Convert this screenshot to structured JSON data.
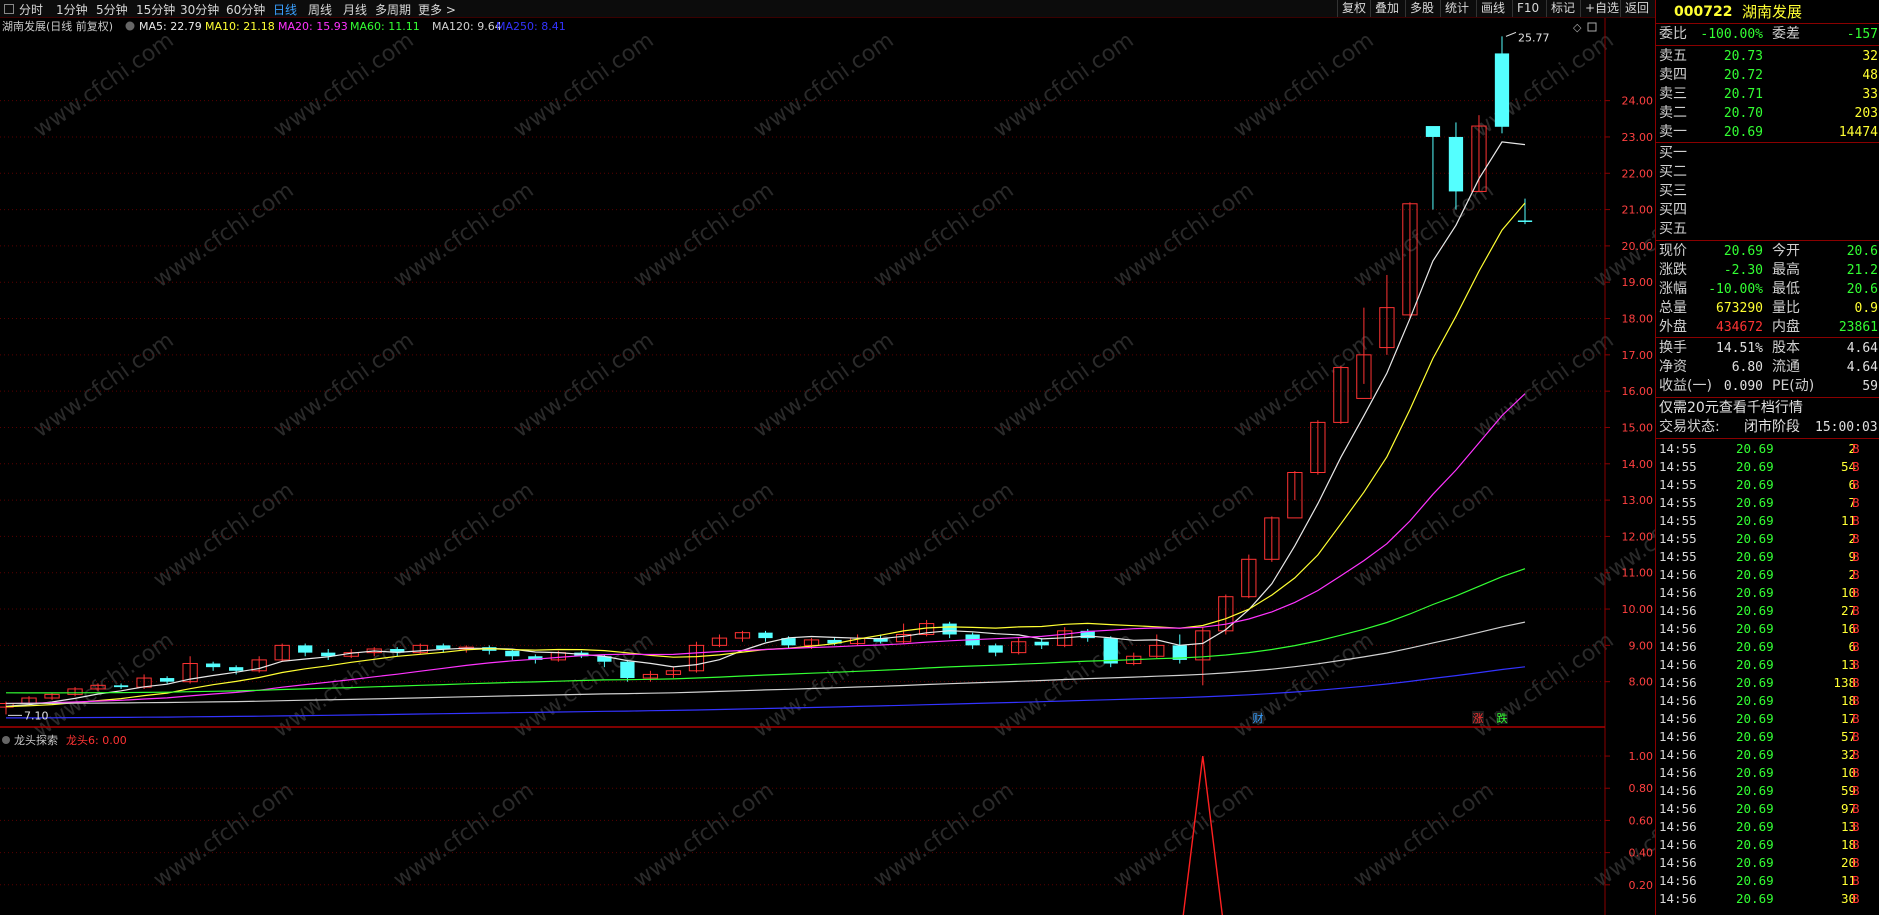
{
  "toolbar": {
    "periods": [
      "分时",
      "1分钟",
      "5分钟",
      "15分钟",
      "30分钟",
      "60分钟",
      "日线",
      "周线",
      "月线",
      "多周期",
      "更多 >"
    ],
    "active_period": "日线",
    "right_buttons": [
      "复权",
      "叠加",
      "多股",
      "统计",
      "画线",
      "F10",
      "标记",
      "+自选",
      "返回"
    ]
  },
  "chart": {
    "title": "湖南发展(日线 前复权)",
    "ma_legend": [
      {
        "label": "MA5: 22.79",
        "color": "#e8e8e8"
      },
      {
        "label": "MA10: 21.18",
        "color": "#ffff33"
      },
      {
        "label": "MA20: 15.93",
        "color": "#ff33ff"
      },
      {
        "label": "MA60: 11.11",
        "color": "#33ff33"
      },
      {
        "label": "MA120: 9.64",
        "color": "#d0d0d0"
      },
      {
        "label": "MA250: 8.41",
        "color": "#3333ff"
      }
    ],
    "high_label": "25.77",
    "low_label": "7.10",
    "markers": [
      {
        "text": "财",
        "color": "#3aa0ff"
      },
      {
        "text": "涨",
        "color": "#ff3333"
      },
      {
        "text": "跌",
        "color": "#33ff33"
      }
    ],
    "indicator_title": "龙头探索",
    "indicator_value": "龙头6: 0.00",
    "watermark": "www.cfchi.com",
    "price_axis": [
      "24.00",
      "23.00",
      "22.00",
      "21.00",
      "20.00",
      "19.00",
      "18.00",
      "17.00",
      "16.00",
      "15.00",
      "14.00",
      "13.00",
      "12.00",
      "11.00",
      "10.00",
      "9.00",
      "8.00"
    ],
    "ind_axis": [
      "1.00",
      "0.80",
      "0.60",
      "0.40",
      "0.20"
    ],
    "colors": {
      "up": "#ff3333",
      "down": "#54ffff",
      "grid": "#5a0000",
      "axis": "#8a0000"
    }
  },
  "chart_data": {
    "type": "candlestick",
    "note_axes": "price y-axis 8.00–24.00; indicator y-axis 0.20–1.00",
    "ylim": [
      7.0,
      26.0
    ],
    "candles": [
      [
        7.3,
        7.4,
        7.45,
        7.1
      ],
      [
        7.4,
        7.55,
        7.6,
        7.35
      ],
      [
        7.55,
        7.65,
        7.7,
        7.5
      ],
      [
        7.65,
        7.8,
        7.85,
        7.6
      ],
      [
        7.8,
        7.9,
        7.95,
        7.75
      ],
      [
        7.9,
        7.85,
        7.95,
        7.8
      ],
      [
        7.85,
        8.1,
        8.2,
        7.8
      ],
      [
        8.1,
        8.0,
        8.15,
        7.95
      ],
      [
        8.0,
        8.5,
        8.7,
        7.95
      ],
      [
        8.5,
        8.4,
        8.55,
        8.3
      ],
      [
        8.4,
        8.3,
        8.45,
        8.2
      ],
      [
        8.3,
        8.6,
        8.7,
        8.25
      ],
      [
        8.6,
        9.0,
        9.05,
        8.55
      ],
      [
        9.0,
        8.8,
        9.05,
        8.7
      ],
      [
        8.8,
        8.7,
        8.9,
        8.6
      ],
      [
        8.7,
        8.8,
        8.9,
        8.65
      ],
      [
        8.8,
        8.9,
        8.95,
        8.7
      ],
      [
        8.9,
        8.8,
        8.95,
        8.7
      ],
      [
        8.8,
        9.0,
        9.05,
        8.75
      ],
      [
        9.0,
        8.9,
        9.05,
        8.8
      ],
      [
        8.9,
        8.95,
        9.0,
        8.8
      ],
      [
        8.95,
        8.85,
        9.0,
        8.75
      ],
      [
        8.85,
        8.7,
        8.9,
        8.6
      ],
      [
        8.7,
        8.6,
        8.75,
        8.5
      ],
      [
        8.6,
        8.8,
        8.85,
        8.55
      ],
      [
        8.8,
        8.7,
        8.85,
        8.65
      ],
      [
        8.7,
        8.55,
        8.75,
        8.4
      ],
      [
        8.55,
        8.1,
        8.6,
        8.0
      ],
      [
        8.1,
        8.2,
        8.3,
        8.0
      ],
      [
        8.2,
        8.3,
        8.4,
        8.1
      ],
      [
        8.3,
        9.0,
        9.1,
        8.25
      ],
      [
        9.0,
        9.2,
        9.3,
        8.95
      ],
      [
        9.2,
        9.35,
        9.4,
        9.1
      ],
      [
        9.35,
        9.2,
        9.4,
        9.1
      ],
      [
        9.2,
        9.0,
        9.25,
        8.9
      ],
      [
        9.0,
        9.15,
        9.2,
        8.9
      ],
      [
        9.15,
        9.05,
        9.2,
        9.0
      ],
      [
        9.05,
        9.2,
        9.3,
        9.0
      ],
      [
        9.2,
        9.1,
        9.3,
        9.05
      ],
      [
        9.1,
        9.3,
        9.6,
        9.05
      ],
      [
        9.3,
        9.6,
        9.7,
        9.25
      ],
      [
        9.6,
        9.3,
        9.65,
        9.2
      ],
      [
        9.3,
        9.0,
        9.35,
        8.9
      ],
      [
        9.0,
        8.8,
        9.05,
        8.7
      ],
      [
        8.8,
        9.1,
        9.2,
        8.75
      ],
      [
        9.1,
        9.0,
        9.2,
        8.9
      ],
      [
        9.0,
        9.4,
        9.5,
        8.95
      ],
      [
        9.4,
        9.2,
        9.45,
        9.1
      ],
      [
        9.2,
        8.5,
        9.25,
        8.4
      ],
      [
        8.5,
        8.7,
        8.8,
        8.45
      ],
      [
        8.7,
        9.0,
        9.3,
        8.65
      ],
      [
        9.0,
        8.6,
        9.3,
        8.5
      ],
      [
        8.6,
        9.4,
        9.5,
        7.9
      ],
      [
        9.4,
        10.34,
        10.4,
        9.3
      ],
      [
        10.34,
        11.37,
        11.5,
        10.3
      ],
      [
        11.37,
        12.51,
        12.55,
        11.3
      ],
      [
        12.51,
        13.76,
        13.8,
        13.0
      ],
      [
        13.76,
        15.14,
        15.2,
        13.7
      ],
      [
        15.14,
        16.65,
        16.7,
        15.1
      ],
      [
        15.8,
        17.0,
        18.3,
        16.2
      ],
      [
        17.2,
        18.3,
        19.2,
        17.0
      ],
      [
        18.1,
        21.16,
        21.2,
        18.0
      ],
      [
        23.3,
        23.0,
        23.28,
        21.0
      ],
      [
        23.0,
        21.5,
        23.4,
        21.0
      ],
      [
        21.5,
        23.3,
        23.6,
        21.5
      ],
      [
        25.3,
        23.28,
        25.77,
        23.1
      ],
      [
        20.7,
        20.69,
        21.3,
        20.6
      ]
    ],
    "ma5_end": 22.79,
    "ma10_end": 21.18,
    "ma20_end": 15.93,
    "ma60_end": 11.11,
    "ma120_end": 9.64,
    "ma250_end": 8.41,
    "indicator": {
      "name": "龙头6",
      "spike_value": 1.0,
      "last": 0.0
    }
  },
  "panel": {
    "code": "000722",
    "name": "湖南发展",
    "weibi_label": "委比",
    "weibi": "-100.00%",
    "weicha_label": "委差",
    "weicha": "-157",
    "asks": [
      {
        "label": "卖五",
        "price": "20.73",
        "vol": "32"
      },
      {
        "label": "卖四",
        "price": "20.72",
        "vol": "48"
      },
      {
        "label": "卖三",
        "price": "20.71",
        "vol": "33"
      },
      {
        "label": "卖二",
        "price": "20.70",
        "vol": "203"
      },
      {
        "label": "卖一",
        "price": "20.69",
        "vol": "14474"
      }
    ],
    "bids": [
      "买一",
      "买二",
      "买三",
      "买四",
      "买五"
    ],
    "stats": [
      {
        "l1": "现价",
        "v1": "20.69",
        "c1": "#33ff33",
        "l2": "今开",
        "v2": "20.6",
        "c2": "#33ff33"
      },
      {
        "l1": "涨跌",
        "v1": "-2.30",
        "c1": "#33ff33",
        "l2": "最高",
        "v2": "21.2",
        "c2": "#33ff33"
      },
      {
        "l1": "涨幅",
        "v1": "-10.00%",
        "c1": "#33ff33",
        "l2": "最低",
        "v2": "20.6",
        "c2": "#33ff33"
      },
      {
        "l1": "总量",
        "v1": "673290",
        "c1": "#ffff33",
        "l2": "量比",
        "v2": "0.9",
        "c2": "#ffff33"
      },
      {
        "l1": "外盘",
        "v1": "434672",
        "c1": "#ff3333",
        "l2": "内盘",
        "v2": "23861",
        "c2": "#33ff33"
      }
    ],
    "fund": [
      {
        "l1": "换手",
        "v1": "14.51%",
        "l2": "股本",
        "v2": "4.64"
      },
      {
        "l1": "净资",
        "v1": "6.80",
        "l2": "流通",
        "v2": "4.64"
      },
      {
        "l1": "收益(一)",
        "v1": "0.090",
        "l2": "PE(动)",
        "v2": "59"
      }
    ],
    "promo": "仅需20元查看千档行情",
    "status_label": "交易状态:",
    "status": "闭市阶段",
    "status_time": "15:00:03",
    "ticks": [
      {
        "t": "14:55",
        "p": "20.69",
        "q": "2",
        "b": "B"
      },
      {
        "t": "14:55",
        "p": "20.69",
        "q": "54",
        "b": "B"
      },
      {
        "t": "14:55",
        "p": "20.69",
        "q": "6",
        "b": "B"
      },
      {
        "t": "14:55",
        "p": "20.69",
        "q": "7",
        "b": "B"
      },
      {
        "t": "14:55",
        "p": "20.69",
        "q": "11",
        "b": "B"
      },
      {
        "t": "14:55",
        "p": "20.69",
        "q": "2",
        "b": "B"
      },
      {
        "t": "14:55",
        "p": "20.69",
        "q": "9",
        "b": "B"
      },
      {
        "t": "14:56",
        "p": "20.69",
        "q": "2",
        "b": "B"
      },
      {
        "t": "14:56",
        "p": "20.69",
        "q": "10",
        "b": "B"
      },
      {
        "t": "14:56",
        "p": "20.69",
        "q": "27",
        "b": "B"
      },
      {
        "t": "14:56",
        "p": "20.69",
        "q": "16",
        "b": "B"
      },
      {
        "t": "14:56",
        "p": "20.69",
        "q": "6",
        "b": "B"
      },
      {
        "t": "14:56",
        "p": "20.69",
        "q": "13",
        "b": "B"
      },
      {
        "t": "14:56",
        "p": "20.69",
        "q": "138",
        "b": "B"
      },
      {
        "t": "14:56",
        "p": "20.69",
        "q": "18",
        "b": "B"
      },
      {
        "t": "14:56",
        "p": "20.69",
        "q": "17",
        "b": "B"
      },
      {
        "t": "14:56",
        "p": "20.69",
        "q": "57",
        "b": "B"
      },
      {
        "t": "14:56",
        "p": "20.69",
        "q": "32",
        "b": "B"
      },
      {
        "t": "14:56",
        "p": "20.69",
        "q": "10",
        "b": "B"
      },
      {
        "t": "14:56",
        "p": "20.69",
        "q": "59",
        "b": "B"
      },
      {
        "t": "14:56",
        "p": "20.69",
        "q": "97",
        "b": "B"
      },
      {
        "t": "14:56",
        "p": "20.69",
        "q": "13",
        "b": "B"
      },
      {
        "t": "14:56",
        "p": "20.69",
        "q": "18",
        "b": "B"
      },
      {
        "t": "14:56",
        "p": "20.69",
        "q": "20",
        "b": "B"
      },
      {
        "t": "14:56",
        "p": "20.69",
        "q": "11",
        "b": "B"
      },
      {
        "t": "14:56",
        "p": "20.69",
        "q": "30",
        "b": "B"
      }
    ]
  }
}
